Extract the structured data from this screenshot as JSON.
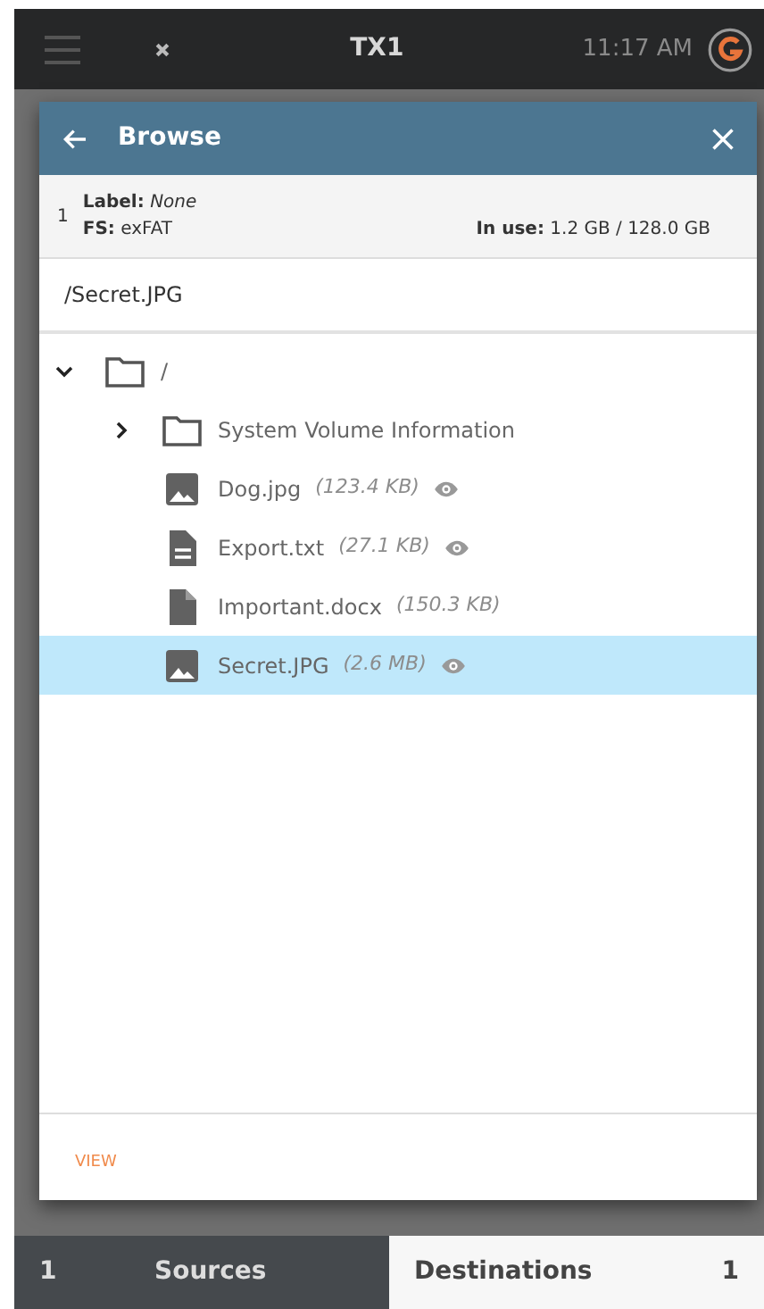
{
  "top_bar": {
    "title": "TX1",
    "time": "11:17 AM"
  },
  "dialog": {
    "title": "Browse",
    "device": {
      "number": "1",
      "label_key": "Label:",
      "label_value": "None",
      "fs_key": "FS:",
      "fs_value": "exFAT",
      "usage_key": "In use:",
      "usage_value": "1.2 GB / 128.0 GB"
    },
    "path": "/Secret.JPG",
    "tree": [
      {
        "kind": "folder",
        "name": "/",
        "expanded": true,
        "selected": false,
        "children": [
          {
            "kind": "folder",
            "name": "System Volume Information",
            "expanded": false,
            "selected": false
          },
          {
            "kind": "image",
            "name": "Dog.jpg",
            "size": "(123.4 KB)",
            "previewable": true,
            "selected": false
          },
          {
            "kind": "text",
            "name": "Export.txt",
            "size": "(27.1 KB)",
            "previewable": true,
            "selected": false
          },
          {
            "kind": "document",
            "name": "Important.docx",
            "size": "(150.3 KB)",
            "previewable": false,
            "selected": false
          },
          {
            "kind": "image",
            "name": "Secret.JPG",
            "size": "(2.6 MB)",
            "previewable": true,
            "selected": true
          }
        ]
      }
    ],
    "footer_action": "VIEW"
  },
  "bottom_tabs": [
    {
      "count": "1",
      "label": "Sources",
      "selected": false
    },
    {
      "label": "Destinations",
      "count": "1",
      "selected": true
    }
  ]
}
